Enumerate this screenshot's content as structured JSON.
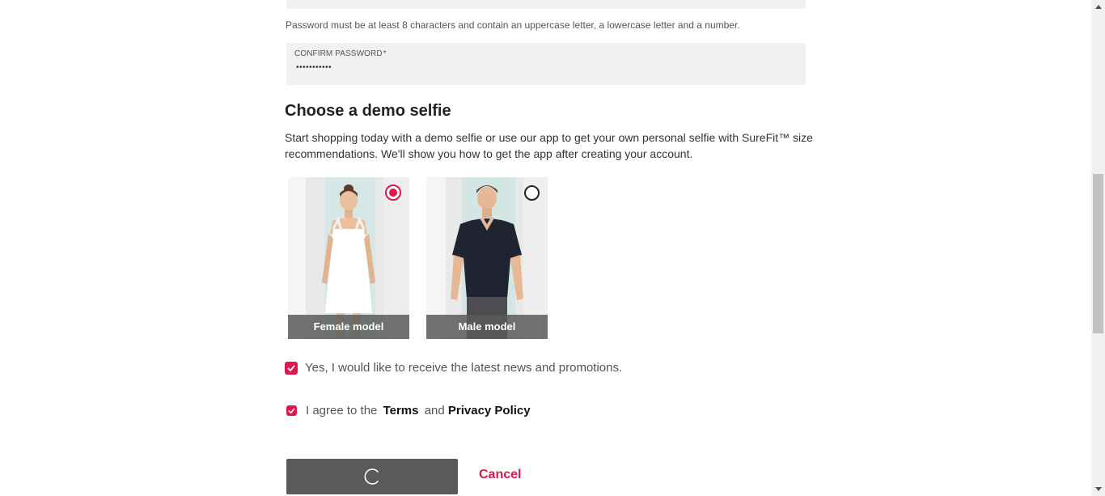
{
  "password": {
    "hint": "Password must be at least 8 characters and contain an uppercase letter, a lowercase letter and a number."
  },
  "confirm_password": {
    "label": "CONFIRM PASSWORD",
    "required_mark": "*",
    "value": "•••••••••••"
  },
  "demo_selfie": {
    "title": "Choose a demo selfie",
    "description": "Start shopping today with a demo selfie or use our app to get your own personal selfie with SureFit™ size recommendations. We'll show you how to get the app after creating your account.",
    "models": [
      {
        "label": "Female model",
        "selected": true
      },
      {
        "label": "Male model",
        "selected": false
      }
    ]
  },
  "news_opt_in": {
    "label": "Yes, I would like to receive the latest news and promotions.",
    "checked": true
  },
  "terms": {
    "prefix": "I agree to the",
    "terms_link": "Terms",
    "conjunction": "and",
    "privacy_link": "Privacy Policy",
    "checked": true
  },
  "actions": {
    "submit_state": "loading",
    "cancel_label": "Cancel"
  },
  "colors": {
    "accent": "#e0164e",
    "field_bg": "#f1f1f1",
    "button_bg": "#5a5a5a"
  }
}
